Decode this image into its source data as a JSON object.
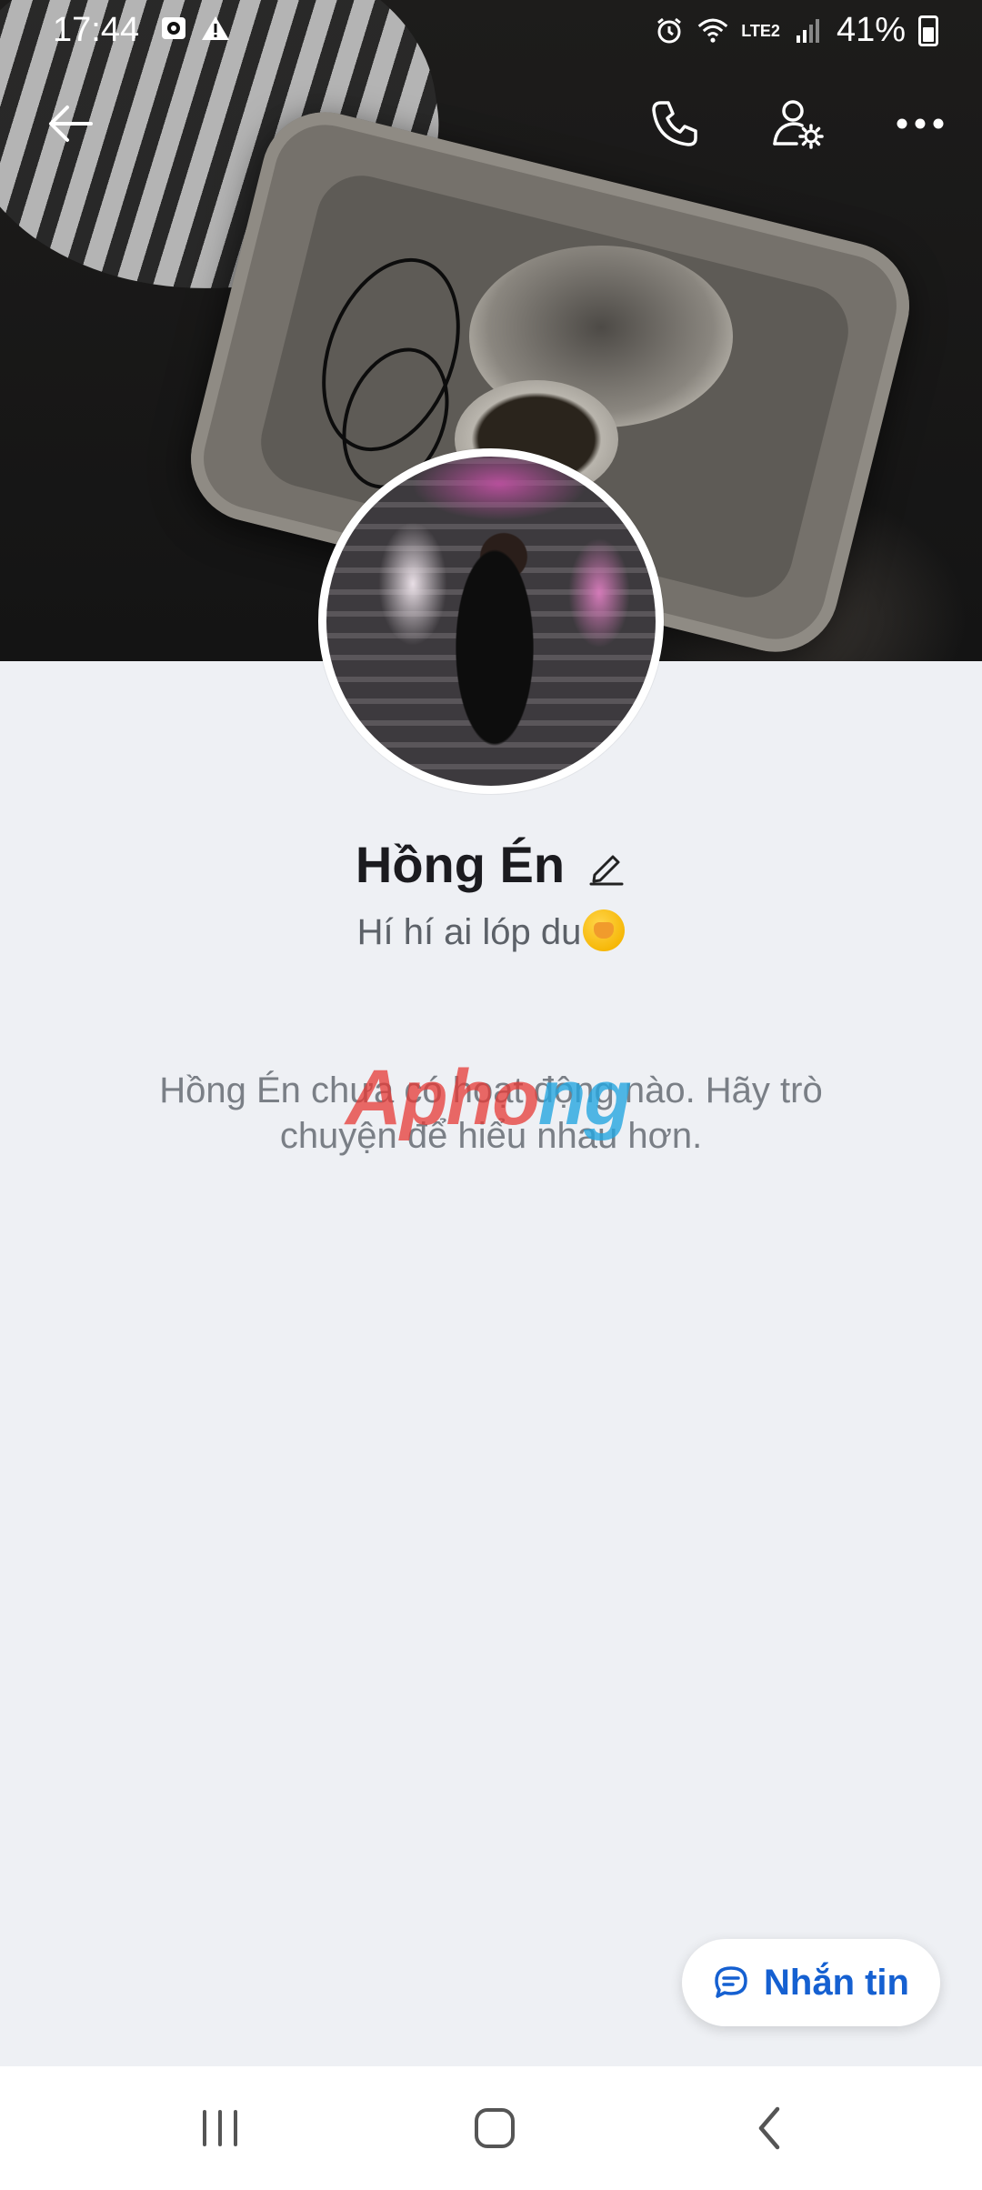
{
  "status_bar": {
    "time": "17:44",
    "battery_text": "41%",
    "network_label": "LTE2"
  },
  "header": {
    "back_icon": "arrow-left-icon",
    "call_icon": "phone-icon",
    "settings_icon": "user-settings-icon",
    "more_icon": "more-dots-icon"
  },
  "profile": {
    "name": "Hồng Én",
    "bio": "Hí hí ai lóp du",
    "bio_emoji": "face-with-hand-over-mouth-emoji"
  },
  "empty_state": {
    "message": "Hồng Én chưa có hoạt động nào. Hãy trò chuyện để hiểu nhau hơn."
  },
  "watermark": {
    "part1": "Apho",
    "part2": "ng"
  },
  "fab": {
    "label": "Nhắn tin",
    "icon": "chat-bubble-icon"
  },
  "colors": {
    "accent": "#1560d1",
    "background": "#eef0f4",
    "text_primary": "#1b1b1f",
    "text_secondary": "#7a7f86"
  }
}
